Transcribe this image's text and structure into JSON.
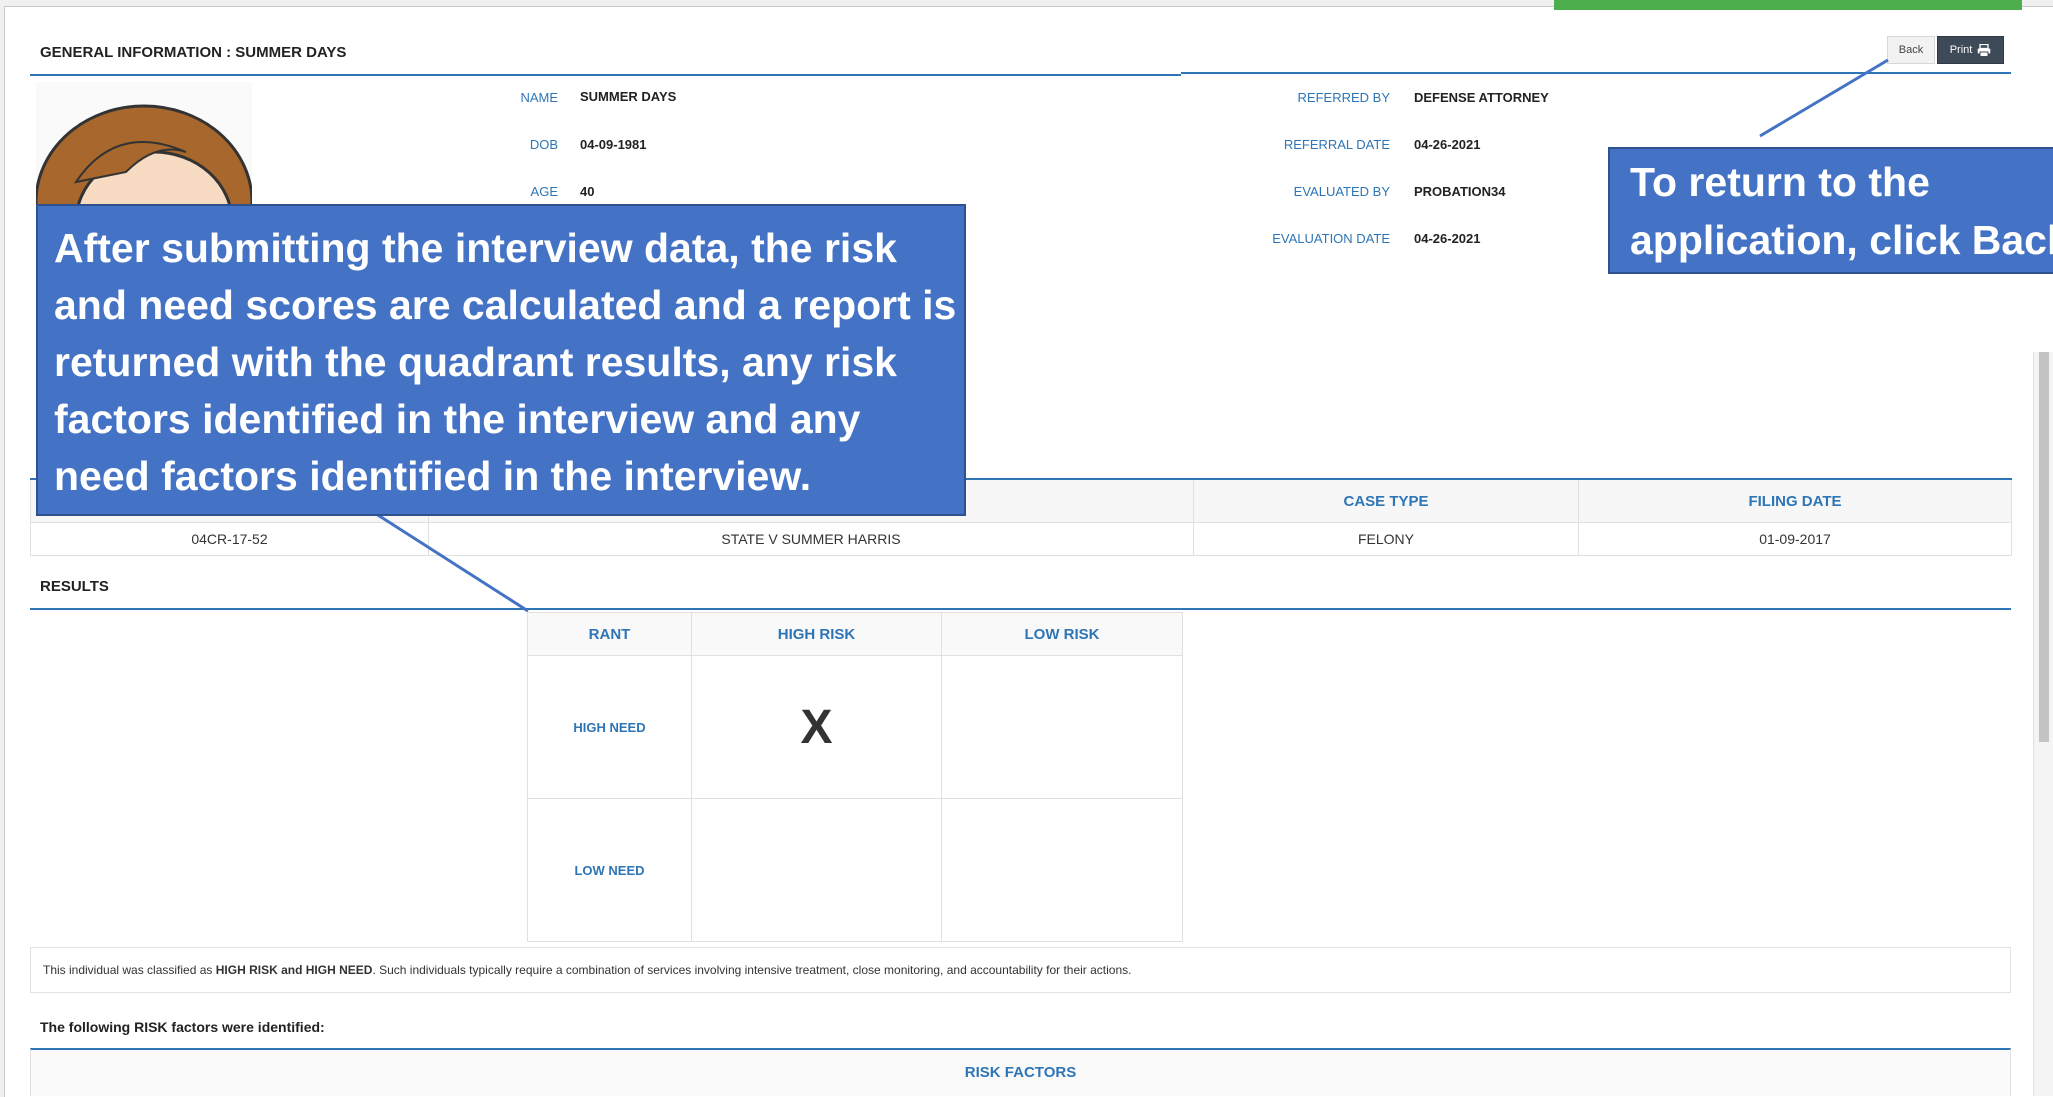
{
  "general": {
    "title": "GENERAL INFORMATION :",
    "title_name": "SUMMER  DAYS",
    "back_label": "Back",
    "print_label": "Print",
    "fields_left": [
      {
        "label": "NAME",
        "value": "SUMMER  DAYS"
      },
      {
        "label": "DOB",
        "value": "04-09-1981"
      },
      {
        "label": "AGE",
        "value": "40"
      }
    ],
    "fields_right": [
      {
        "label": "REFERRED BY",
        "value": "DEFENSE ATTORNEY"
      },
      {
        "label": "REFERRAL DATE",
        "value": "04-26-2021"
      },
      {
        "label": "EVALUATED BY",
        "value": "PROBATION34"
      },
      {
        "label": "EVALUATION DATE",
        "value": "04-26-2021"
      }
    ]
  },
  "case_table": {
    "headers": [
      "",
      "",
      "CASE TYPE",
      "FILING DATE"
    ],
    "row": [
      "04CR-17-52",
      "STATE V SUMMER HARRIS",
      "FELONY",
      "01-09-2017"
    ]
  },
  "results": {
    "title": "RESULTS",
    "quadrant_header": [
      "RANT",
      "HIGH RISK",
      "LOW RISK"
    ],
    "rows": [
      {
        "label": "HIGH NEED",
        "high_risk": "X",
        "low_risk": ""
      },
      {
        "label": "LOW NEED",
        "high_risk": "",
        "low_risk": ""
      }
    ],
    "summary_prefix": "This individual was classified as ",
    "summary_bold": "HIGH RISK and HIGH NEED",
    "summary_suffix": ". Such individuals typically require a combination of services involving intensive treatment, close monitoring, and accountability for their actions.",
    "factors_intro": "The following RISK factors were identified:",
    "factors_header": "RISK FACTORS"
  },
  "callouts": {
    "left": "After submitting the interview data, the risk and need scores are calculated and a report is returned with the quadrant results, any risk factors identified in the interview and any need factors identified in the interview.",
    "right_line1": "To return to the",
    "right_line2": "application, click Back"
  },
  "colors": {
    "accent": "#2e75b6",
    "callout": "#4472c4",
    "print_button": "#3e4a57",
    "status_bar": "#4cae4c"
  }
}
